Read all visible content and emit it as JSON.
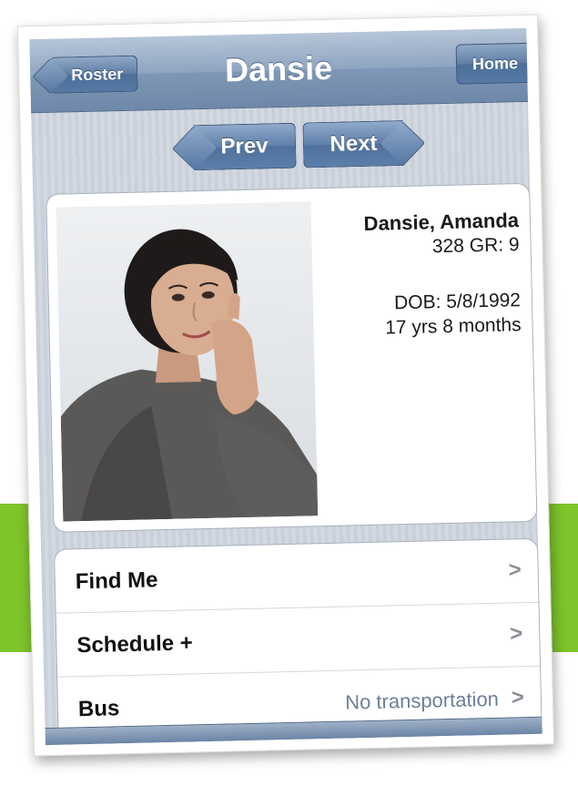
{
  "nav": {
    "title": "Dansie",
    "back_label": "Roster",
    "home_label": "Home"
  },
  "pager": {
    "prev_label": "Prev",
    "next_label": "Next"
  },
  "profile": {
    "name": "Dansie, Amanda",
    "id_grade": "328 GR: 9",
    "dob": "DOB: 5/8/1992",
    "age": "17 yrs 8 months"
  },
  "list": {
    "rows": [
      {
        "label": "Find Me",
        "value": ""
      },
      {
        "label": "Schedule +",
        "value": ""
      },
      {
        "label": "Bus",
        "value": "No transportation"
      }
    ]
  },
  "colors": {
    "nav_blue": "#7f97b6",
    "accent_green": "#7ec42b"
  }
}
